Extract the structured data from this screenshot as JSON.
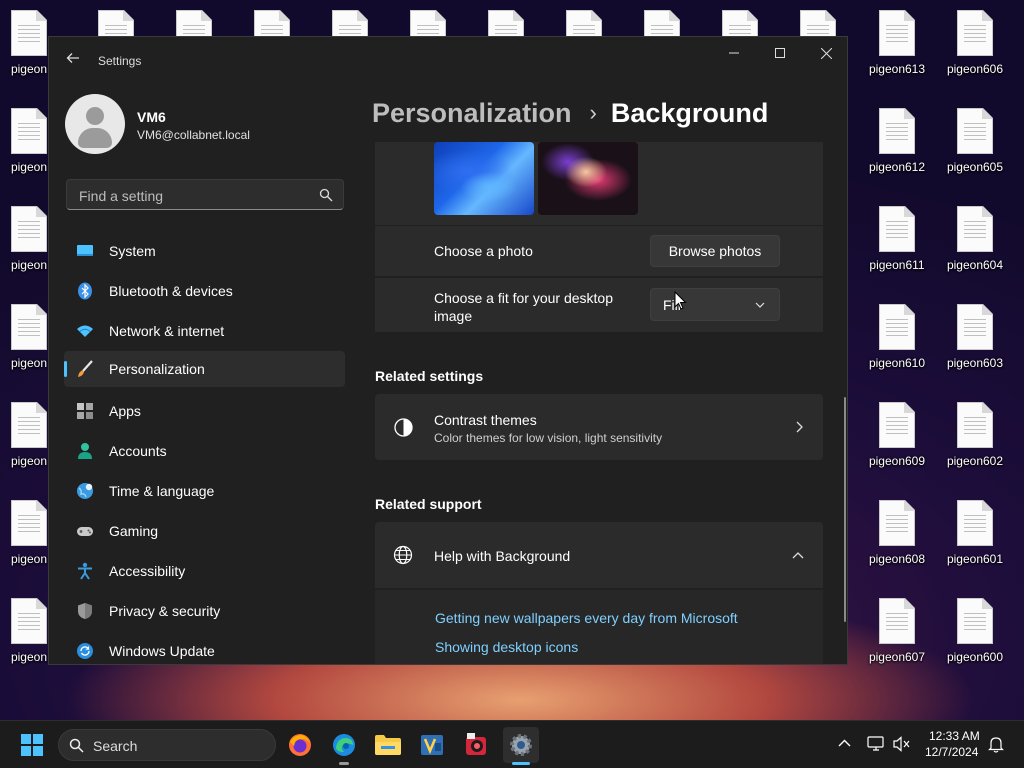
{
  "desktop": {
    "left_labels": [
      "pigeon",
      "pigeon",
      "pigeon",
      "pigeon",
      "pigeon",
      "pigeon",
      "pigeon"
    ],
    "col1": [
      "pigeon613",
      "pigeon612",
      "pigeon611",
      "pigeon610",
      "pigeon609",
      "pigeon608",
      "pigeon607"
    ],
    "col2": [
      "pigeon606",
      "pigeon605",
      "pigeon604",
      "pigeon603",
      "pigeon602",
      "pigeon601",
      "pigeon600"
    ]
  },
  "window": {
    "title": "Settings",
    "controls": {
      "minimize": "—",
      "maximize": "☐",
      "close": "✕"
    }
  },
  "user": {
    "name": "VM6",
    "email": "VM6@collabnet.local"
  },
  "search": {
    "placeholder": "Find a setting"
  },
  "nav": [
    {
      "label": "System",
      "icon": "system-icon"
    },
    {
      "label": "Bluetooth & devices",
      "icon": "bluetooth-icon"
    },
    {
      "label": "Network & internet",
      "icon": "wifi-icon"
    },
    {
      "label": "Personalization",
      "icon": "paintbrush-icon",
      "active": true
    },
    {
      "label": "Apps",
      "icon": "apps-icon"
    },
    {
      "label": "Accounts",
      "icon": "accounts-icon"
    },
    {
      "label": "Time & language",
      "icon": "globe-clock-icon"
    },
    {
      "label": "Gaming",
      "icon": "gamepad-icon"
    },
    {
      "label": "Accessibility",
      "icon": "accessibility-icon"
    },
    {
      "label": "Privacy & security",
      "icon": "shield-icon"
    },
    {
      "label": "Windows Update",
      "icon": "update-icon"
    }
  ],
  "breadcrumb": {
    "parent": "Personalization",
    "separator": "›",
    "current": "Background"
  },
  "background": {
    "choose_photo_label": "Choose a photo",
    "browse_button": "Browse photos",
    "fit_label_line1": "Choose a fit for your desktop",
    "fit_label_line2": "image",
    "fit_value": "Fill"
  },
  "related_settings": {
    "title": "Related settings",
    "contrast_title": "Contrast themes",
    "contrast_sub": "Color themes for low vision, light sensitivity"
  },
  "related_support": {
    "title": "Related support",
    "help_title": "Help with Background",
    "links": [
      "Getting new wallpapers every day from Microsoft",
      "Showing desktop icons"
    ]
  },
  "taskbar": {
    "search_label": "Search",
    "time": "12:33 AM",
    "date": "12/7/2024"
  },
  "colors": {
    "accent": "#4cc2ff",
    "link": "#7fd0ff",
    "window_bg": "#202020",
    "card_bg": "#2b2b2b"
  }
}
